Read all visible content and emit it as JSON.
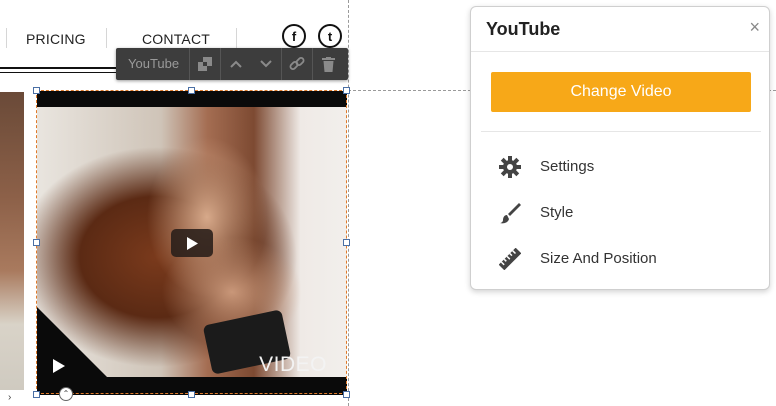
{
  "nav": {
    "pricing_label": "PRICING",
    "contact_label": "CONTACT",
    "facebook_glyph": "f",
    "twitter_glyph": "t"
  },
  "toolbar": {
    "title": "YouTube",
    "icons": [
      "layers-icon",
      "chevron-up-icon",
      "chevron-down-icon",
      "link-icon",
      "trash-icon"
    ]
  },
  "video": {
    "overlay_label": "VIDEO"
  },
  "panel": {
    "title": "YouTube",
    "close_glyph": "×",
    "change_video_label": "Change Video",
    "menu": [
      {
        "label": "Settings",
        "icon": "gear-icon"
      },
      {
        "label": "Style",
        "icon": "brush-icon"
      },
      {
        "label": "Size And Position",
        "icon": "ruler-icon"
      }
    ]
  },
  "colors": {
    "accent": "#f7a818",
    "toolbar_bg": "#3d3d3d",
    "selection_outline": "#e07b2b"
  }
}
